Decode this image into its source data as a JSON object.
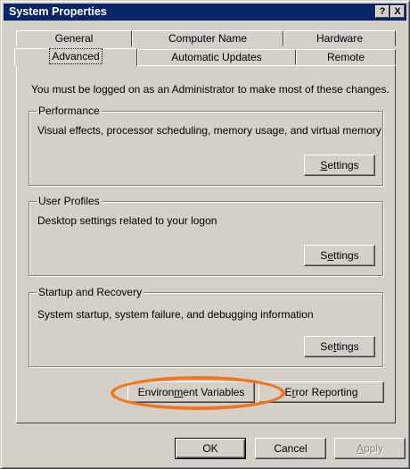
{
  "window": {
    "title": "System Properties"
  },
  "titlebar_buttons": {
    "help": "?",
    "close": "X"
  },
  "tabs_row1": [
    {
      "label": "General"
    },
    {
      "label": "Computer Name"
    },
    {
      "label": "Hardware"
    }
  ],
  "tabs_row2": [
    {
      "label": "Advanced",
      "active": true
    },
    {
      "label": "Automatic Updates"
    },
    {
      "label": "Remote"
    }
  ],
  "intro": "You must be logged on as an Administrator to make most of these changes.",
  "groups": {
    "performance": {
      "title": "Performance",
      "description": "Visual effects, processor scheduling, memory usage, and virtual memory",
      "button": {
        "pre": "",
        "key": "S",
        "post": "ettings"
      }
    },
    "user_profiles": {
      "title": "User Profiles",
      "description": "Desktop settings related to your logon",
      "button": {
        "pre": "S",
        "key": "e",
        "post": "ttings"
      }
    },
    "startup": {
      "title": "Startup and Recovery",
      "description": "System startup, system failure, and debugging information",
      "button": {
        "pre": "Se",
        "key": "t",
        "post": "tings"
      }
    }
  },
  "env_button": {
    "pre": "Environ",
    "key": "m",
    "post": "ent Variables"
  },
  "error_button": {
    "pre": "E",
    "key": "r",
    "post": "ror Reporting"
  },
  "footer": {
    "ok": "OK",
    "cancel": "Cancel",
    "apply": {
      "key": "A",
      "post": "pply"
    }
  },
  "colors": {
    "titlebar": "#0a246a",
    "face": "#d4d0c8",
    "highlight": "#f07522"
  }
}
